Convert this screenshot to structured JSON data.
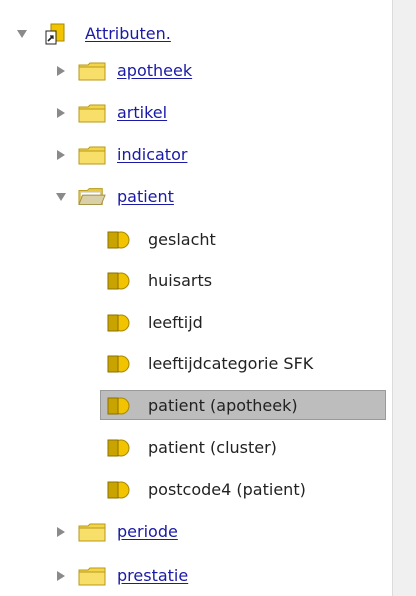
{
  "tree": {
    "root": {
      "label": "Attributen."
    },
    "folders": [
      {
        "label": "apotheek"
      },
      {
        "label": "artikel"
      },
      {
        "label": "indicator"
      },
      {
        "label": "patient"
      },
      {
        "label": "periode"
      },
      {
        "label": "prestatie"
      }
    ],
    "patient_items": [
      {
        "label": "geslacht"
      },
      {
        "label": "huisarts"
      },
      {
        "label": "leeftijd"
      },
      {
        "label": "leeftijdcategorie SFK"
      },
      {
        "label": "patient (apotheek)"
      },
      {
        "label": "patient (cluster)"
      },
      {
        "label": "postcode4 (patient)"
      }
    ],
    "selected_item": "patient (apotheek)"
  },
  "colors": {
    "link": "#1a1aa6",
    "folder": "#f3d54a",
    "attribute": "#c9a400",
    "selection": "#bdbdbd"
  },
  "icons": {
    "root": "attribute-root-icon",
    "folder_closed": "folder-closed-icon",
    "folder_open": "folder-open-icon",
    "attribute": "attribute-icon",
    "expanded": "triangle-down-icon",
    "collapsed": "triangle-right-icon"
  }
}
